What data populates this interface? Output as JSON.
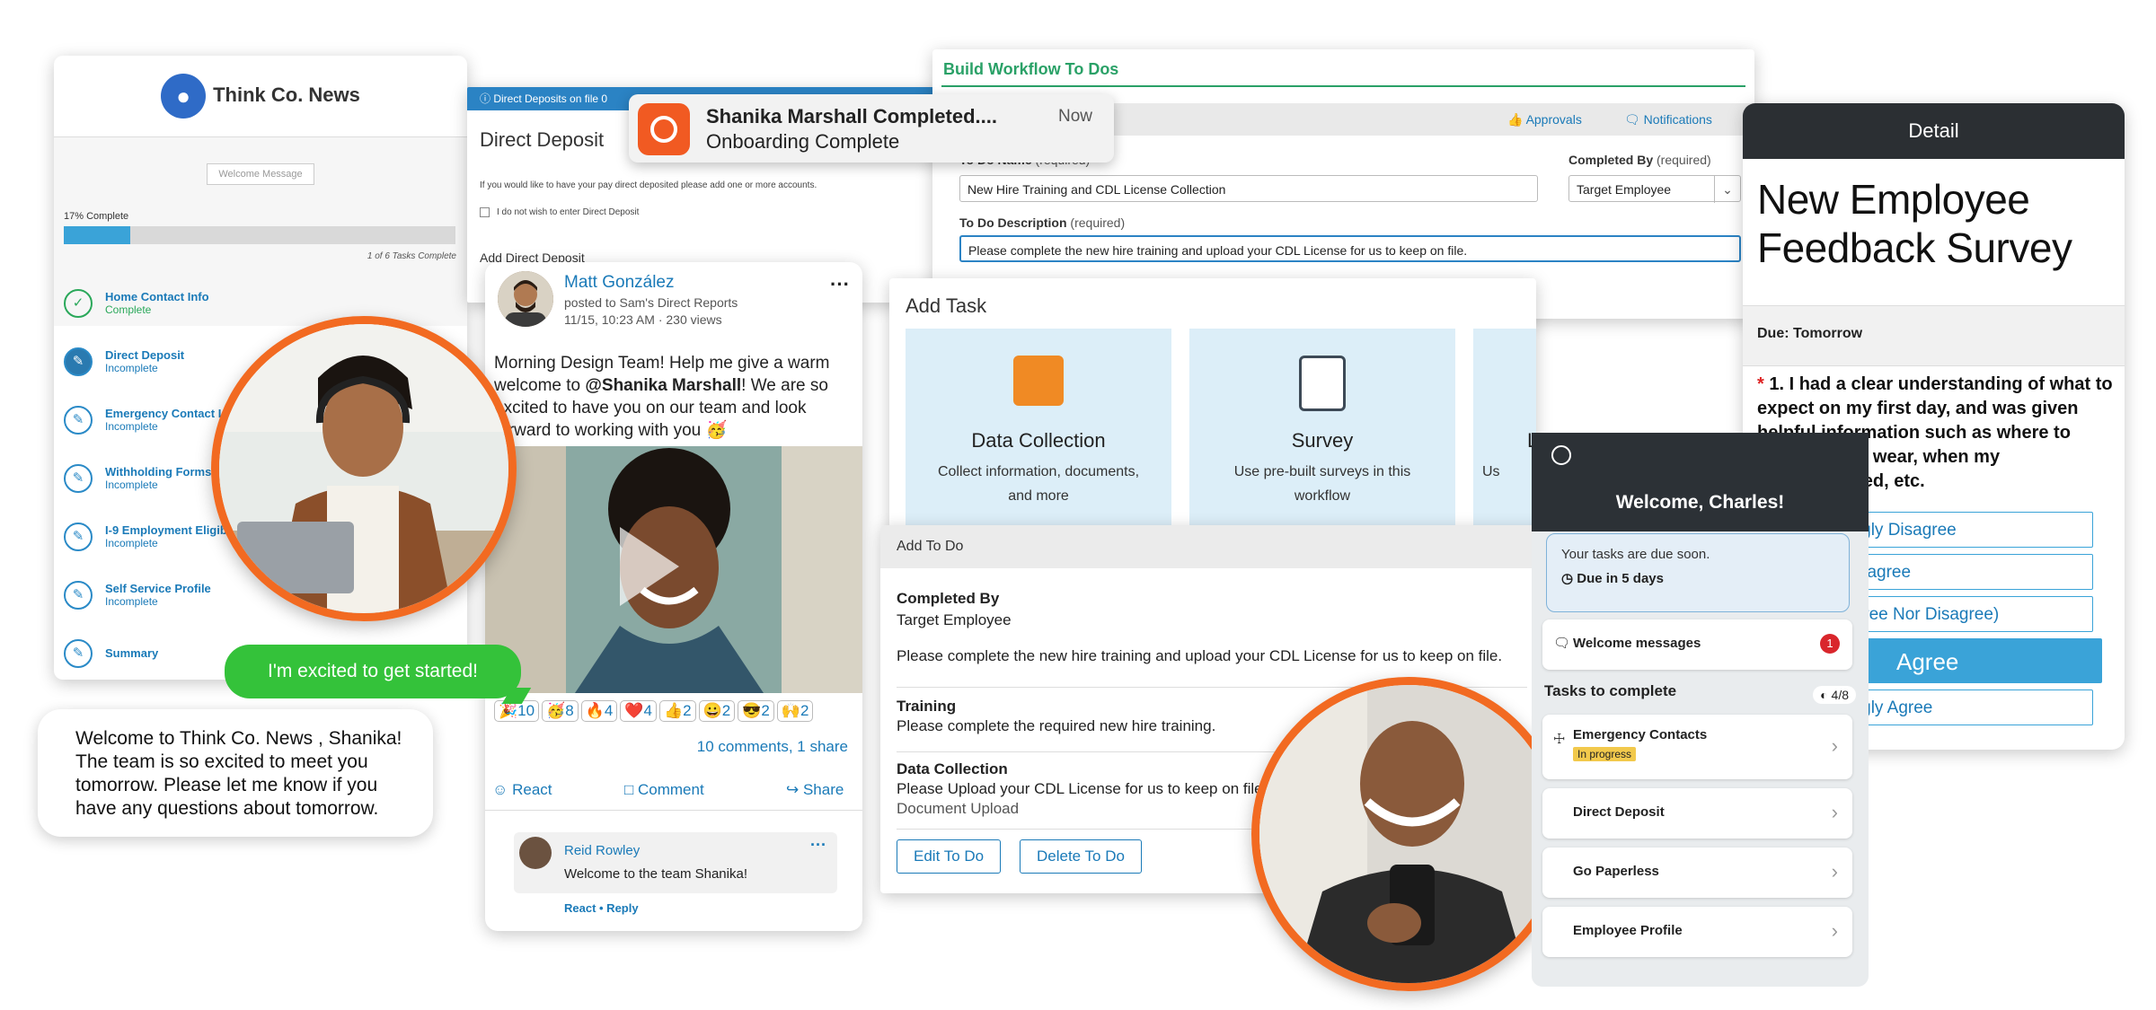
{
  "news": {
    "title": "Think Co. News",
    "welcome_button": "Welcome Message",
    "progress_label": "17% Complete",
    "progress_fraction": 0.17,
    "tasks_count": "1 of 6 Tasks Complete",
    "items": [
      {
        "title": "Home Contact Info",
        "status": "Complete"
      },
      {
        "title": "Direct Deposit",
        "status": "Incomplete"
      },
      {
        "title": "Emergency Contact I",
        "status": "Incomplete"
      },
      {
        "title": "Withholding Forms",
        "status": "Incomplete"
      },
      {
        "title": "I-9 Employment Eligib",
        "status": "Incomplete"
      },
      {
        "title": "Self Service Profile",
        "status": "Incomplete"
      },
      {
        "title": "Summary",
        "status": ""
      }
    ]
  },
  "direct_deposit": {
    "header": "Direct Deposits on file 0",
    "title": "Direct Deposit",
    "info": "If you would like to have your pay direct deposited please add one or more accounts.",
    "checkbox_label": "I do not wish to enter Direct Deposit",
    "add_label": "Add Direct Deposit"
  },
  "toast": {
    "title": "Shanika Marshall Completed....",
    "subtitle": "Onboarding Complete",
    "time": "Now"
  },
  "workflow": {
    "heading": "Build Workflow To Dos",
    "approvals": "Approvals",
    "notifications": "Notifications",
    "todo_name_label": "To Do Name",
    "required": "(required)",
    "todo_name_value": "New Hire Training and CDL License Collection",
    "completed_by_label": "Completed By",
    "completed_by_value": "Target Employee",
    "desc_label": "To Do Description",
    "desc_value": "Please complete the new hire training and upload your CDL License for us to keep on file."
  },
  "survey": {
    "header": "Detail",
    "title_line1": "New Employee",
    "title_line2": "Feedback Survey",
    "due": "Due: Tomorrow",
    "question": "1. I had a clear understanding of what to expect on my first day, and was given helpful information such as where to park, what to wear, when my",
    "question_end": "uld be shipped, etc.",
    "options": [
      "ongly Disagree",
      "Disagree",
      "Agree Nor Disagree)",
      "Agree",
      "ongly Agree"
    ]
  },
  "add_task": {
    "title": "Add Task",
    "tiles": [
      {
        "title": "Data Collection",
        "desc": "Collect information, documents, and more"
      },
      {
        "title": "Survey",
        "desc": "Use pre-built surveys in this workflow"
      },
      {
        "title": "Learning",
        "desc": "Us"
      }
    ]
  },
  "todo": {
    "header": "Add To Do",
    "completed_by_label": "Completed By",
    "completed_by_value": "Target Employee",
    "description": "Please complete the new hire training and upload your CDL License for us to keep on file.",
    "training_label": "Training",
    "training_text": "Please complete the required new hire training.",
    "data_label": "Data Collection",
    "data_text": "Please Upload your CDL License for us to keep on file.",
    "data_sub": "Document Upload",
    "edit_button": "Edit To Do",
    "delete_button": "Delete To Do"
  },
  "post": {
    "author": "Matt González",
    "posted_to": "posted to Sam's Direct Reports",
    "time": "11/15, 10:23 AM · 230 views",
    "body_a": "Morning Design Team! Help me give a warm welcome to ",
    "mention": "@Shanika Marshall",
    "body_b": "! We are so excited to have you on our team and look forward to working with you 🥳",
    "reactions": [
      "🎉10",
      "🥳8",
      "🔥4",
      "❤️4",
      "👍2",
      "😀2",
      "😎2",
      "🙌2"
    ],
    "comments_link": "10 comments, 1 share",
    "react": "React",
    "comment": "Comment",
    "share": "Share",
    "commenter": "Reid Rowley",
    "comment_text": "Welcome to the team Shanika!",
    "comment_actions": "React • Reply"
  },
  "chat": {
    "green": "I'm excited to get started!",
    "white": "Welcome to Think Co. News , Shanika! The team is so excited to meet you tomorrow. Please let me know if you have any questions about tomorrow."
  },
  "mobile": {
    "welcome": "Welcome, Charles!",
    "alert_text": "Your tasks are due soon.",
    "alert_due": "Due in 5 days",
    "welcome_messages": "Welcome messages",
    "badge": "1",
    "tasks_heading": "Tasks to complete",
    "tasks_count": "4/8",
    "tasks": [
      {
        "label": "Emergency Contacts",
        "status": "In progress"
      },
      {
        "label": "Direct Deposit",
        "status": ""
      },
      {
        "label": "Go Paperless",
        "status": ""
      },
      {
        "label": "Employee Profile",
        "status": ""
      }
    ]
  },
  "colors": {
    "accent": "#f26a21",
    "primary_blue": "#1a7ab8",
    "green": "#2aa167"
  }
}
